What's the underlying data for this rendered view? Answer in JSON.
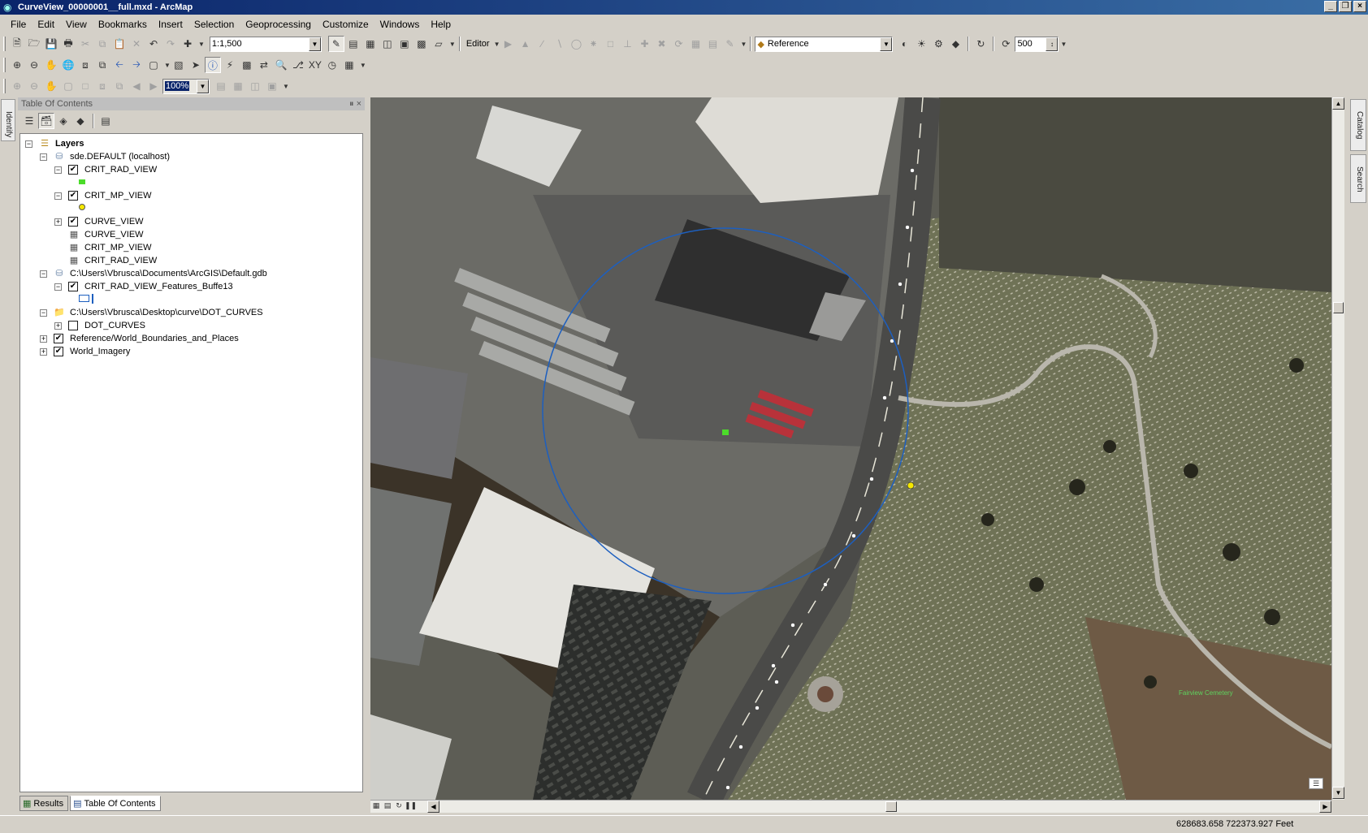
{
  "window": {
    "title": "CurveView_00000001__full.mxd - ArcMap"
  },
  "menu": [
    "File",
    "Edit",
    "View",
    "Bookmarks",
    "Insert",
    "Selection",
    "Geoprocessing",
    "Customize",
    "Windows",
    "Help"
  ],
  "toolbar": {
    "scale": "1:1,500",
    "editor_label": "Editor",
    "reference_value": "Reference",
    "tolerance_value": "500",
    "zoom_percent": "100%"
  },
  "toc": {
    "title": "Table Of Contents",
    "layers_root": "Layers",
    "items": [
      {
        "label": "sde.DEFAULT (localhost)",
        "level": 1,
        "expanded": true,
        "type": "database"
      },
      {
        "label": "CRIT_RAD_VIEW",
        "level": 2,
        "expanded": true,
        "checked": true,
        "symbol": "green-square"
      },
      {
        "label": "CRIT_MP_VIEW",
        "level": 2,
        "expanded": true,
        "checked": true,
        "symbol": "yellow-point"
      },
      {
        "label": "CURVE_VIEW",
        "level": 2,
        "expanded": false,
        "checked": true
      },
      {
        "label": "CURVE_VIEW",
        "level": 2,
        "type": "table"
      },
      {
        "label": "CRIT_MP_VIEW",
        "level": 2,
        "type": "table"
      },
      {
        "label": "CRIT_RAD_VIEW",
        "level": 2,
        "type": "table"
      },
      {
        "label": "C:\\Users\\Vbrusca\\Documents\\ArcGIS\\Default.gdb",
        "level": 1,
        "expanded": true,
        "type": "database"
      },
      {
        "label": "CRIT_RAD_VIEW_Features_Buffe13",
        "level": 2,
        "expanded": true,
        "checked": true,
        "symbol": "blue-polygon"
      },
      {
        "label": "C:\\Users\\Vbrusca\\Desktop\\curve\\DOT_CURVES",
        "level": 1,
        "expanded": true,
        "type": "folder"
      },
      {
        "label": "DOT_CURVES",
        "level": 2,
        "expanded": false,
        "checked": false
      },
      {
        "label": "Reference/World_Boundaries_and_Places",
        "level": 1,
        "expanded": false,
        "checked": true
      },
      {
        "label": "World_Imagery",
        "level": 1,
        "expanded": false,
        "checked": true
      }
    ],
    "tabs": [
      "Results",
      "Table Of Contents"
    ]
  },
  "side_tabs": {
    "left": "Identify",
    "right": [
      "Catalog",
      "Search"
    ]
  },
  "map": {
    "cemetery_label": "Fairview Cemetery"
  },
  "status": {
    "coordinates": "628683.658  722373.927 Feet"
  },
  "colors": {
    "title_gradient_start": "#0a246a",
    "title_gradient_end": "#3a6ea5",
    "buffer_circle": "#1d5fbf",
    "crit_rad_symbol": "#4cdc2a",
    "crit_mp_symbol": "#f5e800"
  }
}
